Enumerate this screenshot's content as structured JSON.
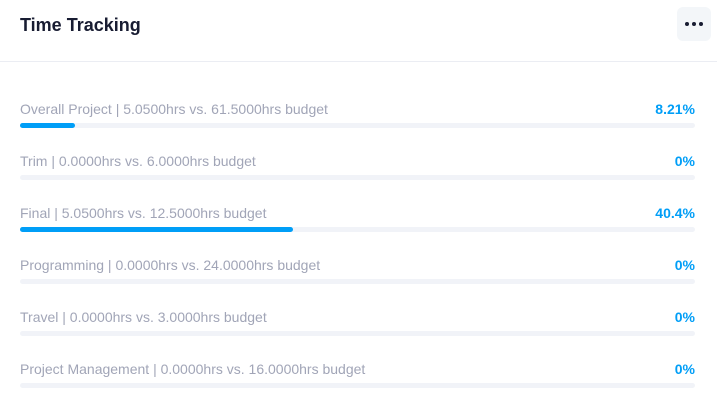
{
  "card": {
    "title": "Time Tracking",
    "menu_icon": "more-horizontal-icon"
  },
  "colors": {
    "accent": "#009ef7",
    "track": "#f1f3f8",
    "label": "#a1a5b7",
    "title": "#181c32"
  },
  "rows": [
    {
      "label": "Overall Project | 5.0500hrs vs. 61.5000hrs budget",
      "percent_text": "8.21%",
      "progress": 0.0821
    },
    {
      "label": "Trim | 0.0000hrs vs. 6.0000hrs budget",
      "percent_text": "0%",
      "progress": 0
    },
    {
      "label": "Final | 5.0500hrs vs. 12.5000hrs budget",
      "percent_text": "40.4%",
      "progress": 0.404
    },
    {
      "label": "Programming | 0.0000hrs vs. 24.0000hrs budget",
      "percent_text": "0%",
      "progress": 0
    },
    {
      "label": "Travel | 0.0000hrs vs. 3.0000hrs budget",
      "percent_text": "0%",
      "progress": 0
    },
    {
      "label": "Project Management | 0.0000hrs vs. 16.0000hrs budget",
      "percent_text": "0%",
      "progress": 0
    }
  ]
}
